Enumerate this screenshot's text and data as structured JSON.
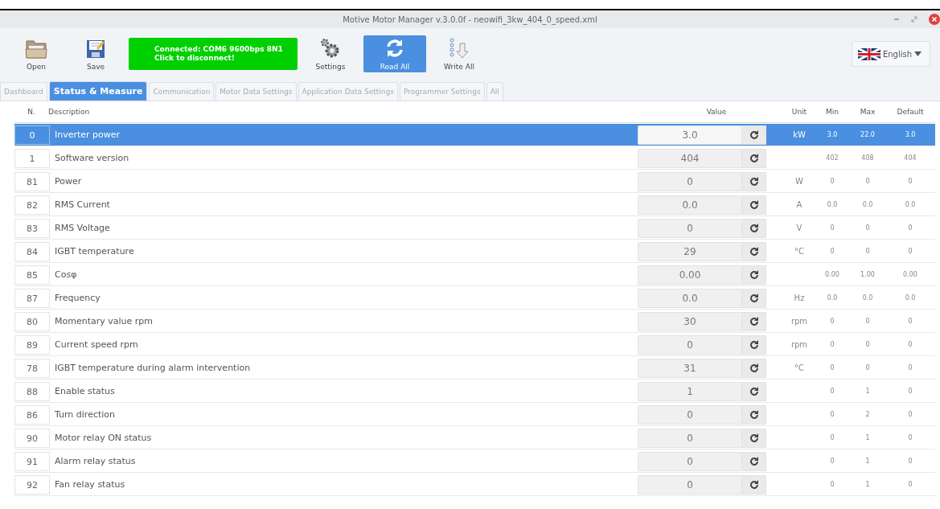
{
  "window": {
    "title": "Motive Motor Manager v.3.0.0f - neowifi_3kw_404_0_speed.xml"
  },
  "toolbar": {
    "open": "Open",
    "save": "Save",
    "connection": {
      "line1": "Connected: COM6 9600bps 8N1",
      "line2": "Click to disconnect!"
    },
    "settings": "Settings",
    "read_all": "Read All",
    "write_all": "Write All",
    "language": "English"
  },
  "tabs": [
    {
      "label": "Dashboard",
      "selected": false
    },
    {
      "label": "Status & Measure",
      "selected": true
    },
    {
      "label": "Communication",
      "selected": false
    },
    {
      "label": "Motor Data Settings",
      "selected": false
    },
    {
      "label": "Application Data Settings",
      "selected": false
    },
    {
      "label": "Programmer Settings",
      "selected": false
    },
    {
      "label": "All",
      "selected": false
    }
  ],
  "table": {
    "columns": [
      "N.",
      "Description",
      "Value",
      "Unit",
      "Min",
      "Max",
      "Default"
    ],
    "rows": [
      {
        "n": "0",
        "description": "Inverter power",
        "value": "3.0",
        "unit": "kW",
        "min": "3.0",
        "max": "22.0",
        "default": "3.0",
        "selected": true
      },
      {
        "n": "1",
        "description": "Software version",
        "value": "404",
        "min": "402",
        "max": "408",
        "default": "404",
        "selected": false
      },
      {
        "n": "81",
        "description": "Power",
        "value": "0",
        "unit": "W",
        "min": "0",
        "max": "0",
        "default": "0",
        "selected": false
      },
      {
        "n": "82",
        "description": "RMS Current",
        "value": "0.0",
        "unit": "A",
        "min": "0.0",
        "max": "0.0",
        "default": "0.0",
        "selected": false
      },
      {
        "n": "83",
        "description": "RMS Voltage",
        "value": "0",
        "unit": "V",
        "min": "0",
        "max": "0",
        "default": "0",
        "selected": false
      },
      {
        "n": "84",
        "description": "IGBT temperature",
        "value": "29",
        "unit": "°C",
        "min": "0",
        "max": "0",
        "default": "0",
        "selected": false
      },
      {
        "n": "85",
        "description": "Cosφ",
        "value": "0.00",
        "min": "0.00",
        "max": "1.00",
        "default": "0.00",
        "selected": false
      },
      {
        "n": "87",
        "description": "Frequency",
        "value": "0.0",
        "unit": "Hz",
        "min": "0.0",
        "max": "0.0",
        "default": "0.0",
        "selected": false
      },
      {
        "n": "80",
        "description": "Momentary value rpm",
        "value": "30",
        "unit": "rpm",
        "min": "0",
        "max": "0",
        "default": "0",
        "selected": false
      },
      {
        "n": "89",
        "description": "Current speed rpm",
        "value": "0",
        "unit": "rpm",
        "min": "0",
        "max": "0",
        "default": "0",
        "selected": false
      },
      {
        "n": "78",
        "description": "IGBT temperature during alarm intervention",
        "value": "31",
        "unit": "°C",
        "min": "0",
        "max": "0",
        "default": "0",
        "selected": false
      },
      {
        "n": "88",
        "description": "Enable status",
        "value": "1",
        "min": "0",
        "max": "1",
        "default": "0",
        "selected": false
      },
      {
        "n": "86",
        "description": "Turn direction",
        "value": "0",
        "min": "0",
        "max": "2",
        "default": "0",
        "selected": false
      },
      {
        "n": "90",
        "description": "Motor relay ON status",
        "value": "0",
        "min": "0",
        "max": "1",
        "default": "0",
        "selected": false
      },
      {
        "n": "91",
        "description": "Alarm relay status",
        "value": "0",
        "min": "0",
        "max": "1",
        "default": "0",
        "selected": false
      },
      {
        "n": "92",
        "description": "Fan relay status",
        "value": "0",
        "min": "0",
        "max": "1",
        "default": "0",
        "selected": false
      }
    ]
  }
}
